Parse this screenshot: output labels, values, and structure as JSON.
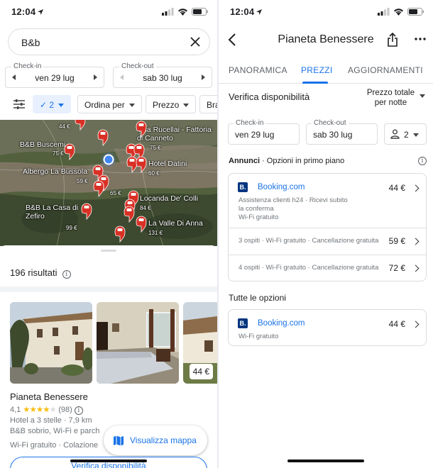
{
  "left": {
    "status": {
      "time": "12:04"
    },
    "search": {
      "query": "B&b"
    },
    "checkin": {
      "label": "Check-in",
      "value": "ven 29 lug"
    },
    "checkout": {
      "label": "Check-out",
      "value": "sab 30 lug"
    },
    "chips": {
      "guests": "2",
      "sort": "Ordina per",
      "price": "Prezzo",
      "more": "Bra"
    },
    "map": {
      "labels": [
        {
          "name": "Villa Rucellai - Fattoria di Canneto",
          "price": "75 €"
        },
        {
          "name": "B&B Buscemi",
          "price": "75 €"
        },
        {
          "name": "Albergo La Bussola",
          "price": "59 €"
        },
        {
          "name": "Hotel Datini",
          "price": "60 €"
        },
        {
          "name": "Locanda De' Colli",
          "price": "84 €"
        },
        {
          "name": "B&B La Casa di Zefiro",
          "price": "99 €"
        },
        {
          "name": "La Valle Di Anna",
          "price": "131 €"
        }
      ],
      "extra_prices": [
        "44 €",
        "65 €"
      ]
    },
    "results_count": "196 risultati",
    "hotel": {
      "name": "Pianeta Benessere",
      "rating": "4,1",
      "stars": "★★★★★",
      "star_fill": 0.82,
      "reviews": "(98)",
      "line1": "Hotel a 3 stelle · 7,9 km",
      "line2": "B&B sobrio, Wi-Fi e parch",
      "line3": "Wi-Fi gratuito · Colazione",
      "price": "44 €"
    },
    "map_button": "Visualizza mappa",
    "check_button": "Verifica disponibilità"
  },
  "right": {
    "status": {
      "time": "12:04"
    },
    "title": "Pianeta Benessere",
    "tabs": [
      "PANORAMICA",
      "PREZZI",
      "AGGIORNAMENTI"
    ],
    "active_tab": "PREZZI",
    "check_label": "Verifica disponibilità",
    "price_mode_1": "Prezzo totale",
    "price_mode_2": "per notte",
    "checkin": {
      "label": "Check-in",
      "value": "ven 29 lug"
    },
    "checkout": {
      "label": "Check-out",
      "value": "sab 30 lug"
    },
    "guests": "2",
    "ads_label": "Annunci",
    "ads_title": " · Opzioni in primo piano",
    "featured": {
      "provider": "Booking.com",
      "price": "44 €",
      "desc1": "Assistenza clienti h24 · Ricevi subito",
      "desc2": "la conferma",
      "desc3": "Wi-Fi gratuito",
      "offers": [
        {
          "text": "3 ospiti · Wi-Fi gratuito · Cancellazione gratuita",
          "price": "59 €"
        },
        {
          "text": "4 ospiti · Wi-Fi gratuito · Cancellazione gratuita",
          "price": "72 €"
        }
      ]
    },
    "all_options": "Tutte le opzioni",
    "option": {
      "provider": "Booking.com",
      "price": "44 €",
      "desc": "Wi-Fi gratuito"
    }
  },
  "colors": {
    "accent": "#1a73e8",
    "booking": "#003580",
    "pin": "#d93025",
    "star": "#fbbc04"
  }
}
